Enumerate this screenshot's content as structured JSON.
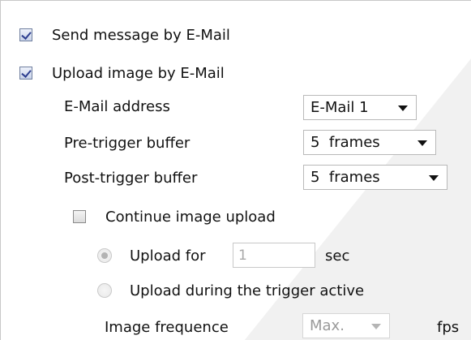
{
  "email_section": {
    "send_message": {
      "label": "Send message by E-Mail",
      "checked": true
    },
    "upload_image": {
      "label": "Upload image by E-Mail",
      "checked": true
    },
    "email_address": {
      "label": "E-Mail address",
      "value": "E-Mail 1"
    },
    "pre_trigger": {
      "label": "Pre-trigger buffer",
      "value": "5  frames"
    },
    "post_trigger": {
      "label": "Post-trigger buffer",
      "value": "5  frames"
    },
    "continue_upload": {
      "label": "Continue image upload",
      "checked": false
    },
    "upload_for": {
      "label": "Upload for",
      "value": "1",
      "unit": "sec",
      "selected": true
    },
    "upload_during": {
      "label": "Upload during the trigger active",
      "selected": false
    },
    "image_frequence": {
      "label": "Image frequence",
      "value": "Max.",
      "unit": "fps"
    }
  },
  "colors": {
    "accent": "#2d3e8f",
    "disabled_text": "#a8a8a8",
    "border": "#c8c8c8"
  }
}
